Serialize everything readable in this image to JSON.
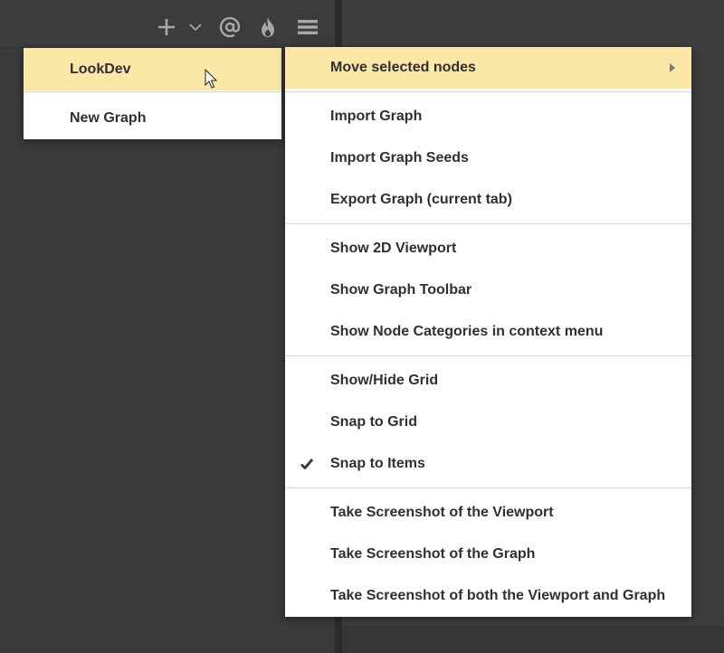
{
  "toolbar": {
    "icons": [
      "plus-icon",
      "chevron-down-icon",
      "at-icon",
      "flame-icon",
      "hamburger-menu-icon"
    ]
  },
  "graph_menu": {
    "items": [
      {
        "label": "LookDev",
        "highlighted": true
      },
      {
        "label": "New Graph",
        "highlighted": false
      }
    ]
  },
  "options_menu": {
    "move_selected_nodes": "Move selected nodes",
    "import_graph": "Import Graph",
    "import_graph_seeds": "Import Graph Seeds",
    "export_graph": "Export Graph (current tab)",
    "show_2d_viewport": "Show 2D Viewport",
    "show_graph_toolbar": "Show Graph Toolbar",
    "show_node_categories": "Show Node Categories in context menu",
    "show_hide_grid": "Show/Hide Grid",
    "snap_to_grid": "Snap to Grid",
    "snap_to_items": "Snap to Items",
    "screenshot_viewport": "Take Screenshot of the Viewport",
    "screenshot_graph": "Take Screenshot of the Graph",
    "screenshot_both": "Take Screenshot of both the Viewport and Graph"
  },
  "colors": {
    "highlight": "#fbe7a6",
    "menu_bg": "#ffffff",
    "menu_text": "#2f2f36",
    "panel_bg": "#3a3a3a",
    "icon": "#a8a8a8"
  }
}
